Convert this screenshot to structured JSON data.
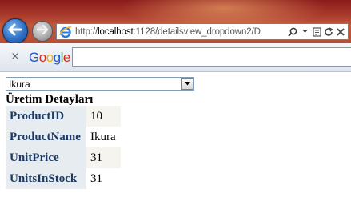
{
  "browser": {
    "url_prefix": "http://",
    "url_host": "localhost",
    "url_rest": ":1128/detailsview_dropdown2/D",
    "icons": [
      "back-arrow-icon",
      "forward-arrow-icon",
      "ie-logo-icon",
      "search-icon",
      "compat-view-icon",
      "refresh-icon",
      "stop-icon"
    ]
  },
  "google_toolbar": {
    "close_symbol": "×",
    "logo_text": [
      "G",
      "o",
      "o",
      "g",
      "l",
      "e"
    ],
    "search_value": ""
  },
  "page": {
    "dropdown_value": "Ikura",
    "heading": "Üretim Detayları",
    "details": [
      {
        "field": "ProductID",
        "value": "10"
      },
      {
        "field": "ProductName",
        "value": "Ikura"
      },
      {
        "field": "UnitPrice",
        "value": "31"
      },
      {
        "field": "UnitsInStock",
        "value": "31"
      }
    ]
  },
  "colors": {
    "field_header_bg": "#e7ecf1",
    "field_header_text": "#1c3a63",
    "alt_row_bg": "#f5f4ef"
  }
}
